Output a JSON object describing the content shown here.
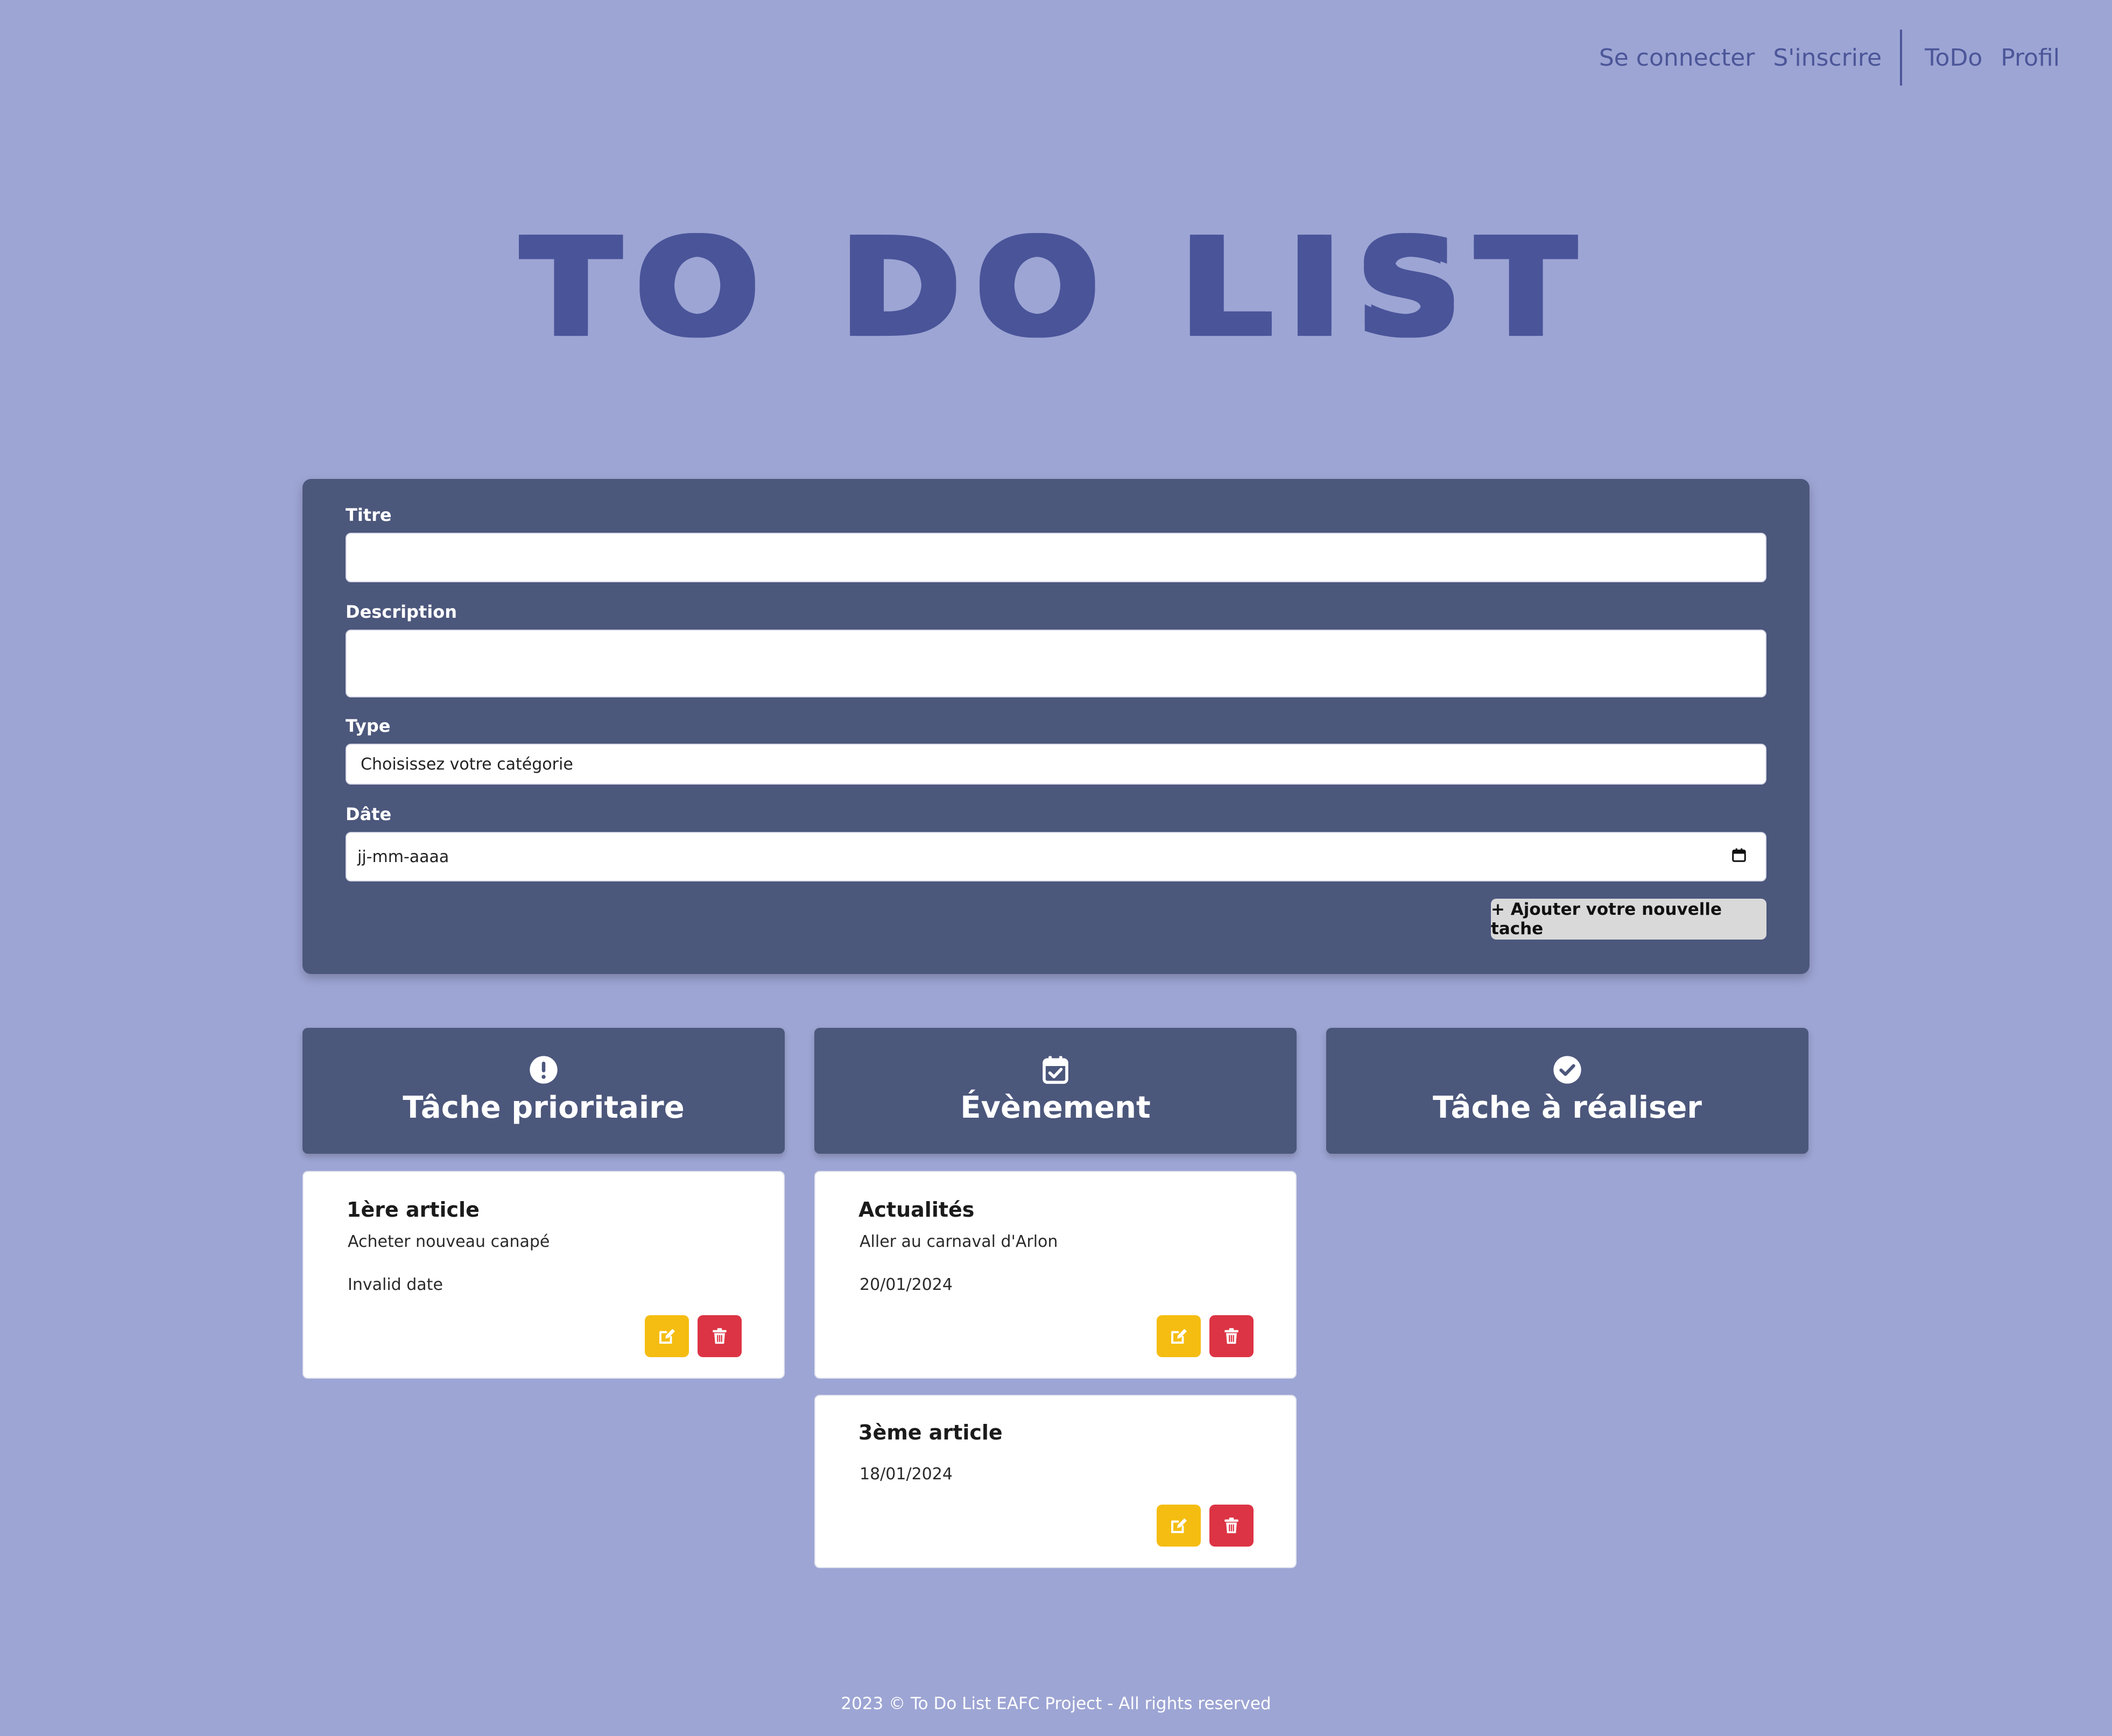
{
  "nav": {
    "login": "Se connecter",
    "register": "S'inscrire",
    "todo": "ToDo",
    "profile": "Profil"
  },
  "app_title": "To Do List",
  "form": {
    "title_label": "Titre",
    "title_value": "",
    "description_label": "Description",
    "description_value": "",
    "type_label": "Type",
    "type_selected": "Choisissez votre catégorie",
    "date_label": "Dâte",
    "date_placeholder": "jj-mm-aaaa",
    "add_button": "+ Ajouter votre nouvelle tache"
  },
  "columns": [
    {
      "title": "Tâche prioritaire",
      "icon": "exclamation-circle-icon"
    },
    {
      "title": "Évènement",
      "icon": "calendar-check-icon"
    },
    {
      "title": "Tâche à réaliser",
      "icon": "check-circle-icon"
    }
  ],
  "cards": {
    "priority": [
      {
        "title": "1ère article",
        "description": "Acheter nouveau canapé",
        "date": "Invalid date"
      }
    ],
    "event": [
      {
        "title": "Actualités",
        "description": "Aller au carnaval d'Arlon",
        "date": "20/01/2024"
      },
      {
        "title": "3ème article",
        "description": "",
        "date": "18/01/2024"
      }
    ],
    "todo": []
  },
  "footer": "2023 © To Do List EAFC Project - All rights reserved",
  "colors": {
    "background": "#9da5d4",
    "panel": "#4c577c",
    "accent": "#4a5499",
    "edit": "#f5bd11",
    "delete": "#dc3444"
  }
}
